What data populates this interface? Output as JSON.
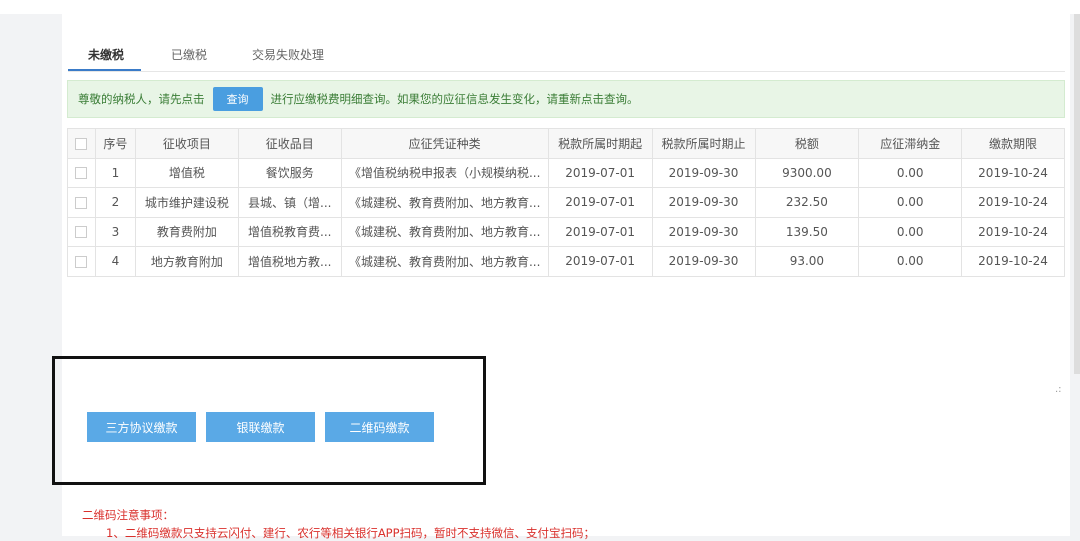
{
  "tabs": [
    "未缴税",
    "已缴税",
    "交易失败处理"
  ],
  "notice": {
    "before": "尊敬的纳税人，请先点击",
    "button": "查询",
    "after": "进行应缴税费明细查询。如果您的应征信息发生变化，请重新点击查询。"
  },
  "table": {
    "headers": [
      "序号",
      "征收项目",
      "征收品目",
      "应征凭证种类",
      "税款所属时期起",
      "税款所属时期止",
      "税额",
      "应征滞纳金",
      "缴款期限"
    ],
    "rows": [
      [
        "1",
        "增值税",
        "餐饮服务",
        "《增值税纳税申报表（小规模纳税...",
        "2019-07-01",
        "2019-09-30",
        "9300.00",
        "0.00",
        "2019-10-24"
      ],
      [
        "2",
        "城市维护建设税",
        "县城、镇（增...",
        "《城建税、教育费附加、地方教育...",
        "2019-07-01",
        "2019-09-30",
        "232.50",
        "0.00",
        "2019-10-24"
      ],
      [
        "3",
        "教育费附加",
        "增值税教育费...",
        "《城建税、教育费附加、地方教育...",
        "2019-07-01",
        "2019-09-30",
        "139.50",
        "0.00",
        "2019-10-24"
      ],
      [
        "4",
        "地方教育附加",
        "增值税地方教...",
        "《城建税、教育费附加、地方教育...",
        "2019-07-01",
        "2019-09-30",
        "93.00",
        "0.00",
        "2019-10-24"
      ]
    ]
  },
  "buttons": [
    "三方协议缴款",
    "银联缴款",
    "二维码缴款"
  ],
  "qr_notes": {
    "title": "二维码注意事项：",
    "item1": "1、二维码缴款只支持云闪付、建行、农行等相关银行APP扫码，暂时不支持微信、支付宝扫码；"
  }
}
